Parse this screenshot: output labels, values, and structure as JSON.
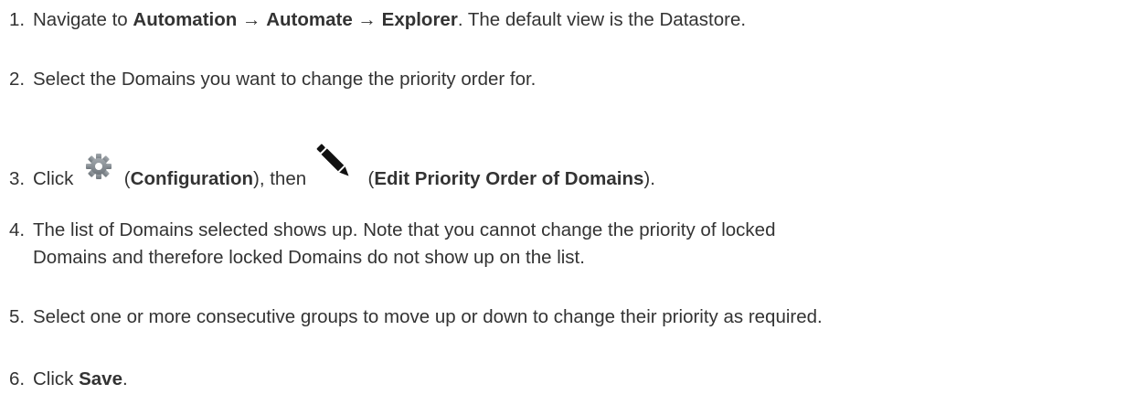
{
  "steps": [
    {
      "num": "1.",
      "t1": "Navigate to ",
      "b1": "Automation",
      "arrow1": " → ",
      "b2": "Automate",
      "arrow2": " → ",
      "b3": "Explorer",
      "t2": ". The default view is the Datastore."
    },
    {
      "num": "2.",
      "text": "Select the Domains you want to change the priority order for."
    },
    {
      "num": "3.",
      "t1": "Click ",
      "icon1": "gear-icon",
      "t2": " (",
      "b1": "Configuration",
      "t3": "), then ",
      "icon2": "pencil-icon",
      "t4": " (",
      "b2": "Edit Priority Order of Domains",
      "t5": ")."
    },
    {
      "num": "4.",
      "line1": "The list of Domains selected shows up. Note that you cannot change the priority of locked",
      "line2": "Domains and therefore locked Domains do not show up on the list."
    },
    {
      "num": "5.",
      "text": "Select one or more consecutive groups to move up or down to change their priority as required."
    },
    {
      "num": "6.",
      "t1": "Click ",
      "b1": "Save",
      "t2": "."
    }
  ],
  "colors": {
    "text": "#333333",
    "gear": "#8a9096",
    "pencil": "#111111"
  }
}
